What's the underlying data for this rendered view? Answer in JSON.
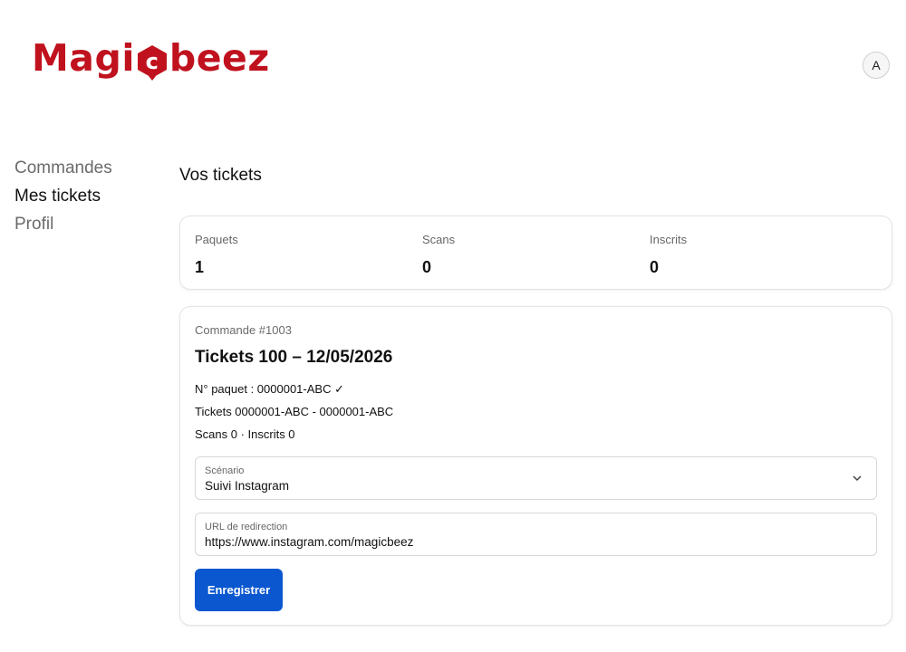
{
  "brand": {
    "logo_left": "Magi",
    "logo_mid": "c",
    "logo_right": "beez",
    "color": "#c0121e"
  },
  "user": {
    "avatar_initial": "A"
  },
  "sidebar": {
    "items": [
      {
        "label": "Commandes",
        "active": false
      },
      {
        "label": "Mes tickets",
        "active": true
      },
      {
        "label": "Profil",
        "active": false
      }
    ]
  },
  "page": {
    "title": "Vos tickets"
  },
  "stats": [
    {
      "label": "Paquets",
      "value": "1"
    },
    {
      "label": "Scans",
      "value": "0"
    },
    {
      "label": "Inscrits",
      "value": "0"
    }
  ],
  "order": {
    "number": "Commande #1003",
    "title": "Tickets 100 – 12/05/2026",
    "package": "N° paquet : 0000001-ABC ✓",
    "tickets": "Tickets 0000001-ABC - 0000001-ABC",
    "scans": "Scans 0 · Inscrits 0",
    "scenario": {
      "label": "Scénario",
      "value": "Suivi Instagram"
    },
    "redirect": {
      "label": "URL de redirection",
      "value": "https://www.instagram.com/magicbeez"
    },
    "save_label": "Enregistrer"
  },
  "colors": {
    "accent": "#0b57d0"
  }
}
